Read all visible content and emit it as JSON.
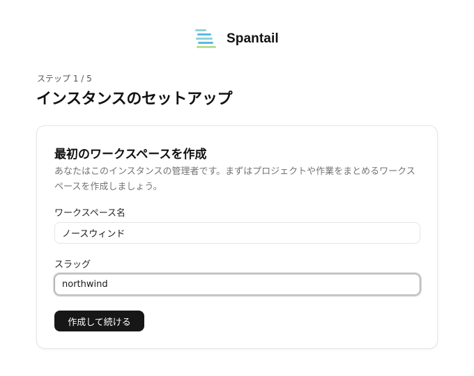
{
  "brand": {
    "name": "Spantail",
    "logo_icon": "striped-bars-logo-icon",
    "colors": {
      "teal": "#8fd3d1",
      "sky": "#5bb8e6",
      "lime": "#b8e08a"
    }
  },
  "step": {
    "label": "ステップ 1 / 5"
  },
  "page": {
    "title": "インスタンスのセットアップ"
  },
  "card": {
    "title": "最初のワークスペースを作成",
    "description": "あなたはこのインスタンスの管理者です。まずはプロジェクトや作業をまとめるワークスペースを作成しましょう。",
    "fields": {
      "name": {
        "label": "ワークスペース名",
        "value": "ノースウィンド"
      },
      "slug": {
        "label": "スラッグ",
        "value": "northwind"
      }
    },
    "submit_label": "作成して続ける"
  },
  "theme": {
    "button_bg": "#171717",
    "border": "#e5e5e5"
  }
}
